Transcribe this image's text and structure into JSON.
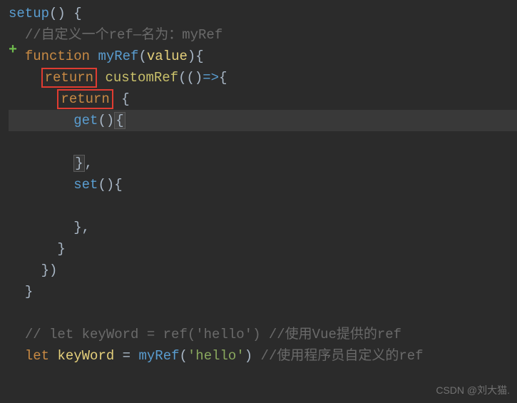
{
  "code": {
    "setup": "setup",
    "paren_open": "(",
    "paren_close": ")",
    "brace_open": "{",
    "brace_close": "}",
    "comment1": "//自定义一个ref—名为：myRef",
    "function_kw": "function",
    "myRef": "myRef",
    "value": "value",
    "return_kw": "return",
    "customRef": "customRef",
    "arrow": "=>",
    "get_fn": "get",
    "set_fn": "set",
    "comma": ",",
    "comment2": "// let keyWord = ref('hello') //使用Vue提供的ref",
    "let_kw": "let",
    "keyWord": "keyWord",
    "equals": "=",
    "string_hello": "'hello'",
    "comment3": "//使用程序员自定义的ref",
    "closing_paren_brace": "})"
  },
  "watermark": "CSDN @刘大猫."
}
